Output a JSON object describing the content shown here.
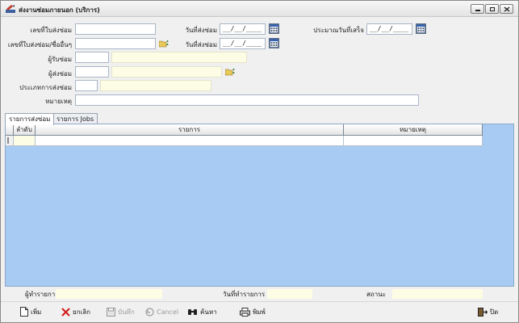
{
  "window": {
    "title": "ส่งงานซ่อมภายนอก (บริการ)"
  },
  "form": {
    "repair_no_label": "เลขที่ใบส่งซ่อม",
    "repair_no_value": "",
    "repair_ref_label": "เลขที่ใบส่งซ่อม/ชื่ออื่นๆ",
    "repair_ref_value": "",
    "send_date_label": "วันที่ส่งซ่อม",
    "send_date_value": "__/__/____",
    "send_date2_label": "วันที่ส่งซ่อม",
    "send_date2_value": "__/__/____",
    "est_finish_label": "ประมาณวันที่เสร็จ",
    "est_finish_value": "__/__/____",
    "receiver_label": "ผู้รับซ่อม",
    "sender_label": "ผู้ส่งซ่อม",
    "repair_type_label": "ประเภทการส่งซ่อม",
    "remark_label": "หมายเหตุ"
  },
  "tabs": [
    {
      "label": "รายการส่งซ่อม"
    },
    {
      "label": "รายการ Jobs"
    }
  ],
  "grid": {
    "columns": [
      "ลำดับ",
      "รายการ",
      "หมายเหตุ"
    ]
  },
  "status": {
    "creator_label": "ผู้ทำรายการ",
    "date_label": "วันที่ทำรายการ",
    "state_label": "สถานะ"
  },
  "toolbar": {
    "add": "เพิ่ม",
    "cancel_doc": "ยกเลิก",
    "save": "บันทึก",
    "cancel": "Cancel",
    "search": "ค้นหา",
    "print": "พิมพ์",
    "close": "ปิด"
  },
  "colors": {
    "grid_background": "#a7cbf2",
    "readonly_field": "#fdfde6",
    "delete_icon": "#d42020"
  }
}
